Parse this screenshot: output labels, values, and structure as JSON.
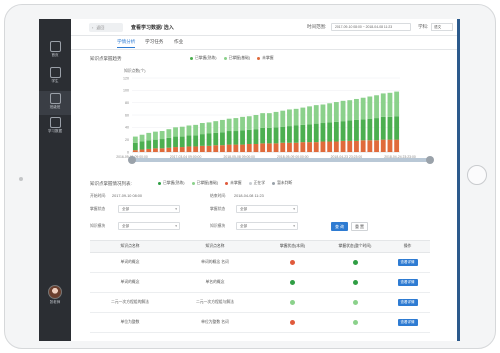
{
  "sidebar": {
    "items": [
      {
        "label": "首页",
        "icon": "home-icon"
      },
      {
        "label": "学生",
        "icon": "student-icon"
      },
      {
        "label": "班级班",
        "icon": "class-icon"
      },
      {
        "label": "学习数据",
        "icon": "data-icon"
      }
    ],
    "user": {
      "name": "张老师"
    }
  },
  "header": {
    "back_label": "返回",
    "title": "查看学习数据/ 选入",
    "time_label": "时间范围:",
    "date_range": "2017-09-10 08:00 ~ 2018-04-08 11:23",
    "subject_label": "学科:",
    "subject_value": "语文"
  },
  "tabs": [
    {
      "label": "学情分析",
      "active": true
    },
    {
      "label": "学习任务",
      "active": false
    },
    {
      "label": "作业",
      "active": false
    }
  ],
  "section1": {
    "title": "知识点掌握趋势",
    "legend": [
      {
        "label": "已掌握(熟练)",
        "color": "#4caf50"
      },
      {
        "label": "已掌握(基础)",
        "color": "#8bd18b"
      },
      {
        "label": "未掌握",
        "color": "#e06a3b"
      }
    ]
  },
  "section2": {
    "title": "知识点掌握情况列表:",
    "legend": [
      {
        "label": "已掌握(熟练)",
        "color": "#2f9e44"
      },
      {
        "label": "已掌握(基础)",
        "color": "#8bd18b"
      },
      {
        "label": "未掌握",
        "color": "#e05a3b"
      },
      {
        "label": "正在学",
        "color": "#c9cdd2"
      },
      {
        "label": "暂未判断",
        "color": "#9aa2aa"
      }
    ],
    "start_label": "开始时间:",
    "start_value": "2017-09-10 08:00",
    "end_label": "结束时间:",
    "end_value": "2018-04-08 11:23",
    "filters": [
      {
        "label": "掌握状态",
        "value": "全部"
      },
      {
        "label": "掌握状态",
        "value": "全部"
      },
      {
        "label": "知识模块",
        "value": "全部"
      },
      {
        "label": "知识模块",
        "value": "全部"
      }
    ],
    "query_label": "查 询",
    "reset_label": "重 置"
  },
  "table": {
    "headers": [
      "知识点名称",
      "知识点名称",
      "掌握状态(本周)",
      "掌握状态(整个时间)",
      "操作"
    ],
    "rows": [
      {
        "a": "单词的概念",
        "b": "单词的概念 名词",
        "s1": "#e05a3b",
        "s2": "#2f9e44",
        "action": "查看详情"
      },
      {
        "a": "单词的概念",
        "b": "单名的概念",
        "s1": "#2f9e44",
        "s2": "#2f9e44",
        "action": "查看详情"
      },
      {
        "a": "二元一次方程组的解法",
        "b": "二元一次方程组与解法",
        "s1": "#8bd18b",
        "s2": "#8bd18b",
        "action": "查看详情"
      },
      {
        "a": "单位为整数",
        "b": "单位为整数  名词",
        "s1": "#e05a3b",
        "s2": "#8bd18b",
        "action": "查看详情"
      }
    ]
  },
  "chart_data": {
    "type": "bar",
    "stacked": true,
    "ylabel": "知识点数(个)",
    "ylim": [
      0,
      120
    ],
    "yticks": [
      0,
      20,
      40,
      60,
      80,
      100,
      120
    ],
    "xticks": [
      "2016-09-01 09:00:00",
      "2017-03-04 09:00:00",
      "2018-05-08 09:00:00",
      "2018-05-09 00:00:00",
      "2018-04-23 23:23:00",
      "2018-04-24 23:23:00"
    ],
    "legend_position": "top",
    "grid": true,
    "series": [
      {
        "name": "未掌握",
        "color": "#e06a3b",
        "values": [
          3,
          4,
          5,
          6,
          6,
          7,
          8,
          8,
          9,
          9,
          10,
          10,
          11,
          11,
          12,
          12,
          12,
          13,
          13,
          14,
          14,
          14,
          15,
          15,
          15,
          16,
          16,
          16,
          17,
          17,
          17,
          18,
          18,
          18,
          19,
          19,
          19,
          20,
          20,
          20
        ]
      },
      {
        "name": "已掌握(熟练)",
        "color": "#4caf50",
        "values": [
          12,
          13,
          14,
          14,
          15,
          16,
          17,
          17,
          18,
          18,
          19,
          20,
          20,
          21,
          22,
          22,
          23,
          23,
          24,
          25,
          25,
          26,
          26,
          27,
          28,
          28,
          29,
          30,
          30,
          31,
          32,
          32,
          33,
          34,
          34,
          35,
          36,
          37,
          37,
          38
        ]
      },
      {
        "name": "已掌握(基础)",
        "color": "#8bd18b",
        "values": [
          10,
          11,
          12,
          13,
          13,
          14,
          15,
          16,
          16,
          17,
          18,
          18,
          19,
          20,
          20,
          21,
          22,
          22,
          23,
          24,
          24,
          25,
          26,
          27,
          27,
          28,
          29,
          30,
          30,
          31,
          32,
          33,
          33,
          34,
          35,
          36,
          37,
          38,
          39,
          40
        ]
      }
    ]
  }
}
